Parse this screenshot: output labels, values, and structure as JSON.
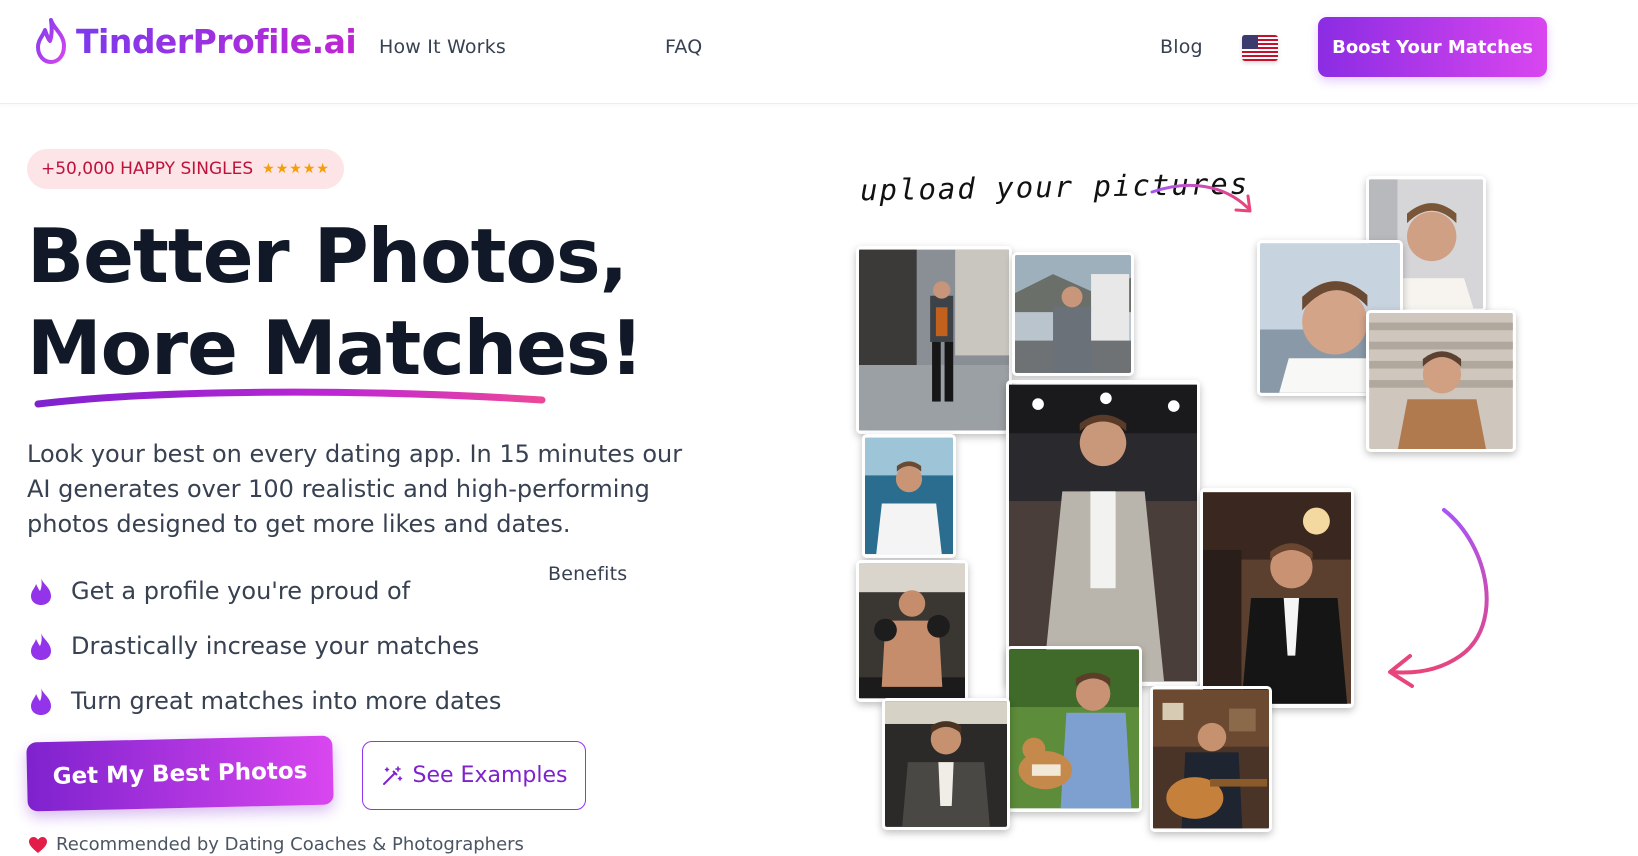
{
  "nav": {
    "logo_text": "TinderProfile.ai",
    "links": [
      "How It Works",
      "Benefits",
      "FAQ"
    ],
    "blog": "Blog",
    "language_flag": "us-flag-icon",
    "cta": "Boost Your Matches"
  },
  "hero": {
    "badge_text": "+50,000 HAPPY SINGLES",
    "badge_stars": "★★★★★",
    "headline_line1": "Better Photos,",
    "headline_line2": "More Matches!",
    "description": "Look your best on every dating app. In 15 minutes our AI generates over 100 realistic and high-performing photos designed to get more likes and dates.",
    "benefits": [
      "Get a profile you're proud of",
      "Drastically increase your matches",
      "Turn great matches into more dates"
    ],
    "primary_cta": "Get My Best Photos",
    "secondary_cta": "See Examples",
    "recommended": "Recommended by Dating Coaches & Photographers"
  },
  "visual": {
    "upload_label": "upload your pictures",
    "photos": [
      {
        "name": "photo-street-walk"
      },
      {
        "name": "photo-helicopter"
      },
      {
        "name": "photo-fashion-show"
      },
      {
        "name": "photo-sea-boat"
      },
      {
        "name": "photo-boxing"
      },
      {
        "name": "photo-gala-tuxedo"
      },
      {
        "name": "photo-park-dog"
      },
      {
        "name": "photo-car-interior"
      },
      {
        "name": "photo-guitar"
      },
      {
        "name": "upload-photo-office"
      },
      {
        "name": "upload-photo-selfie"
      },
      {
        "name": "upload-photo-stairs"
      }
    ]
  },
  "colors": {
    "accent_purple": "#8b2ce3",
    "accent_pink": "#d946ef",
    "badge_bg": "#fde4e6",
    "badge_text": "#be123c",
    "star": "#f59e0b",
    "arrow": "#e8457a"
  }
}
